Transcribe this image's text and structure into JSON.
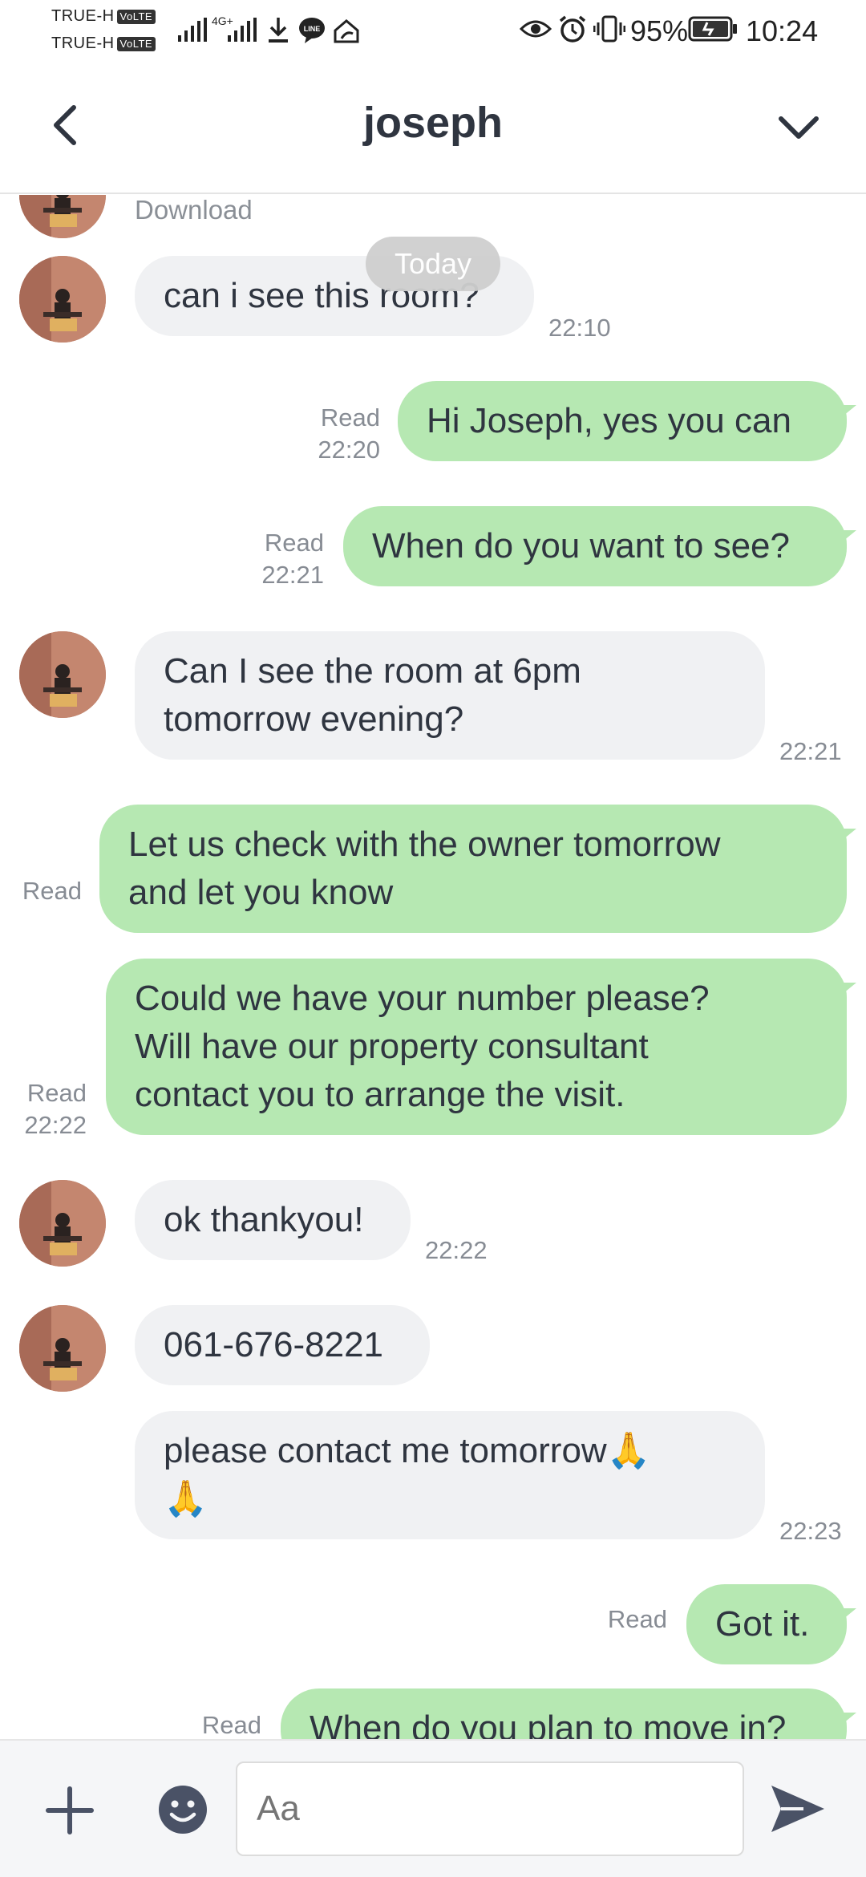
{
  "status_bar": {
    "carrier_1": "TRUE-H",
    "carrier_2": "TRUE-H",
    "volte_badge": "VoLTE",
    "network_label": "4G+",
    "battery": "95%",
    "time": "10:24"
  },
  "header": {
    "title": "joseph"
  },
  "chat": {
    "partial_top_text": "Download",
    "date_pill": "Today",
    "messages": [
      {
        "direction": "in",
        "text": "can i see this room?",
        "time": "22:10"
      },
      {
        "direction": "out",
        "text": "Hi Joseph, yes you can",
        "status": "Read",
        "time": "22:20"
      },
      {
        "direction": "out",
        "text": "When do you want to see?",
        "status": "Read",
        "time": "22:21"
      },
      {
        "direction": "in",
        "text": "Can I see the room at 6pm\ntomorrow evening?",
        "time": "22:21"
      },
      {
        "direction": "out",
        "text": "Let us check with the owner tomorrow\nand let you know",
        "status": "Read",
        "time": ""
      },
      {
        "direction": "out",
        "text": "Could we have your number please?\nWill have our property consultant\ncontact you to arrange the visit.",
        "status": "Read",
        "time": "22:22"
      },
      {
        "direction": "in",
        "text": "ok thankyou!",
        "time": "22:22"
      },
      {
        "direction": "in",
        "text": "061-676-8221",
        "time": ""
      },
      {
        "direction": "in",
        "text": "please contact me tomorrow🙏\n🙏",
        "time": "22:23"
      },
      {
        "direction": "out",
        "text": "Got it.",
        "status": "Read",
        "time": ""
      },
      {
        "direction": "out",
        "text": "When do you plan to move in?",
        "status": "Read",
        "time": ""
      }
    ]
  },
  "input_bar": {
    "placeholder": "Aa"
  },
  "colors": {
    "outgoing_bubble": "#b6e8b2",
    "incoming_bubble": "#f0f1f3",
    "text": "#2f3540",
    "meta": "#878c94"
  },
  "icons": {
    "back": "chevron-left-icon",
    "menu": "chevron-down-icon",
    "plus": "plus-icon",
    "emoji": "smiley-icon",
    "send": "send-icon"
  }
}
